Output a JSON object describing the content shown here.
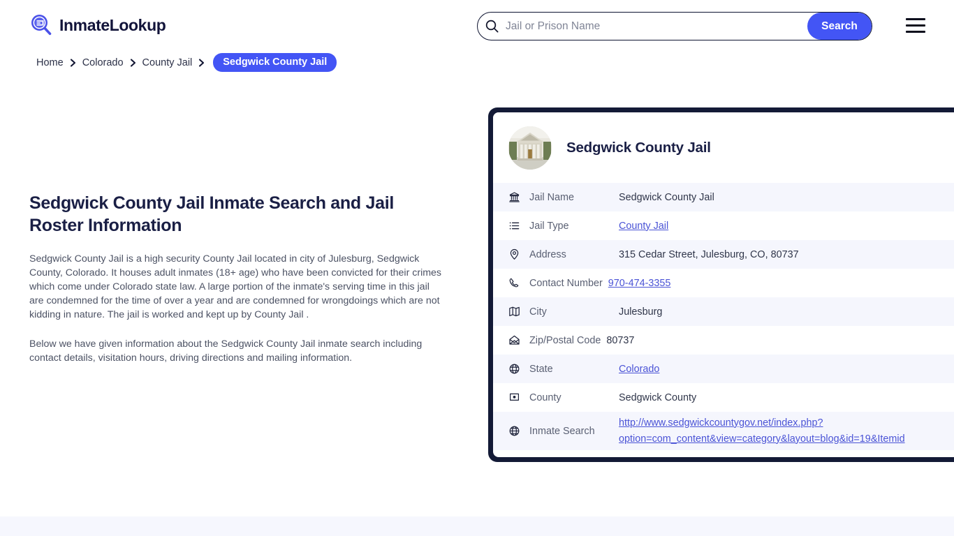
{
  "header": {
    "logo_text": "InmateLookup",
    "logo_icon": "magnifier-logo-icon",
    "menu_icon": "hamburger-menu-icon"
  },
  "search": {
    "placeholder": "Jail or Prison Name",
    "value": "",
    "button_label": "Search",
    "icon": "search-icon"
  },
  "breadcrumb": {
    "items": [
      {
        "label": "Home"
      },
      {
        "label": "Colorado"
      },
      {
        "label": "County Jail"
      }
    ],
    "current": "Sedgwick County Jail",
    "separator_icon": "chevron-right-icon"
  },
  "main": {
    "title": "Sedgwick County Jail Inmate Search and Jail Roster Information",
    "paragraph1": "Sedgwick County Jail is a high security County Jail located in city of Julesburg, Sedgwick County, Colorado. It houses adult inmates (18+ age) who have been convicted for their crimes which come under Colorado state law. A large portion of the inmate's serving time in this jail are condemned for the time of over a year and are condemned for wrongdoings which are not kidding in nature. The jail is worked and kept up by County Jail .",
    "paragraph2": "Below we have given information about the Sedgwick County Jail inmate search including contact details, visitation hours, driving directions and mailing information."
  },
  "card": {
    "title": "Sedgwick County Jail",
    "avatar_icon": "courthouse-building-photo",
    "rows": [
      {
        "icon": "bank-icon",
        "label": "Jail Name",
        "value": "Sedgwick County Jail",
        "link": false
      },
      {
        "icon": "list-icon",
        "label": "Jail Type",
        "value": "County Jail",
        "link": true
      },
      {
        "icon": "map-pin-icon",
        "label": "Address",
        "value": "315 Cedar Street, Julesburg, CO, 80737",
        "link": false
      },
      {
        "icon": "phone-icon",
        "label": "Contact Number",
        "value": "970-474-3355",
        "link": true
      },
      {
        "icon": "map-icon",
        "label": "City",
        "value": "Julesburg",
        "link": false
      },
      {
        "icon": "envelope-icon",
        "label": "Zip/Postal Code",
        "value": "80737",
        "link": false
      },
      {
        "icon": "globe-grid-icon",
        "label": "State",
        "value": "Colorado",
        "link": true
      },
      {
        "icon": "flag-pin-icon",
        "label": "County",
        "value": "Sedgwick County",
        "link": false
      }
    ],
    "inmate_search": {
      "icon": "globe-icon",
      "label": "Inmate Search",
      "url_line1": "http://www.sedgwickcountygov.net/index.php?",
      "url_line2": "option=com_content&view=category&layout=blog&id=19&Itemid"
    }
  },
  "colors": {
    "accent": "#4355f5",
    "card_border": "#131a36",
    "link": "#4a53d6",
    "row_alt_bg": "#f5f6fd",
    "heading": "#1a1f45",
    "footer_band": "#f6f7fe"
  }
}
